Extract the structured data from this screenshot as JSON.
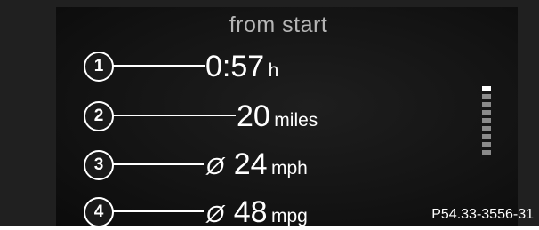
{
  "screen_title": "from start",
  "rows": [
    {
      "callout": "1",
      "symbol": "",
      "value": "0:57",
      "unit": "h"
    },
    {
      "callout": "2",
      "symbol": "",
      "value": "20",
      "unit": "miles"
    },
    {
      "callout": "3",
      "symbol": "Ø",
      "value": "24",
      "unit": "mph"
    },
    {
      "callout": "4",
      "symbol": "Ø",
      "value": "48",
      "unit": "mpg"
    }
  ],
  "scroll_indicator": {
    "segments": 9,
    "active_segment": 1
  },
  "figure_ref": "P54.33-3556-31"
}
